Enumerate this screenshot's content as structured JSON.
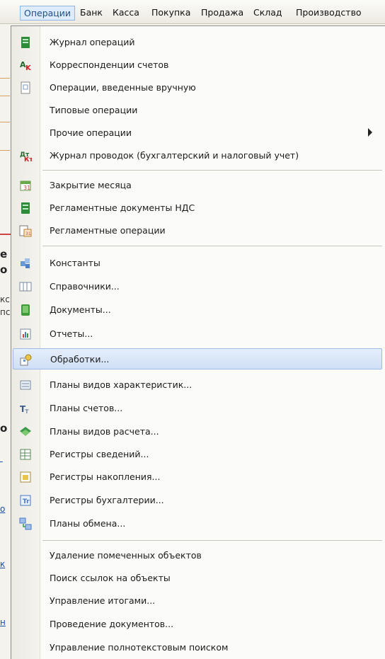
{
  "menubar": {
    "items": [
      "Операции",
      "Банк",
      "Касса",
      "Покупка",
      "Продажа",
      "Склад",
      "Производство"
    ]
  },
  "menu": {
    "items": [
      {
        "label": "Журнал операций",
        "icon": "journal-icon"
      },
      {
        "label": "Корреспонденции счетов",
        "icon": "account-correspondence-icon"
      },
      {
        "label": "Операции, введенные вручную",
        "icon": "manual-operations-icon"
      },
      {
        "label": "Типовые операции",
        "icon": ""
      },
      {
        "label": "Прочие операции",
        "icon": "",
        "submenu": true
      },
      {
        "label": "Журнал проводок (бухгалтерский и налоговый учет)",
        "icon": "postings-journal-icon"
      },
      {
        "label": "Закрытие месяца",
        "icon": "month-close-icon"
      },
      {
        "label": "Регламентные документы НДС",
        "icon": "vat-documents-icon"
      },
      {
        "label": "Регламентные операции",
        "icon": "scheduled-operations-icon"
      },
      {
        "label": "Константы",
        "icon": "constants-icon"
      },
      {
        "label": "Справочники...",
        "icon": "catalogs-icon"
      },
      {
        "label": "Документы...",
        "icon": "documents-icon"
      },
      {
        "label": "Отчеты...",
        "icon": "reports-icon"
      },
      {
        "label": "Обработки...",
        "icon": "data-processors-icon",
        "highlighted": true
      },
      {
        "label": "Планы видов характеристик...",
        "icon": "characteristic-types-icon"
      },
      {
        "label": "Планы счетов...",
        "icon": "chart-of-accounts-icon"
      },
      {
        "label": "Планы видов расчета...",
        "icon": "calculation-types-icon"
      },
      {
        "label": "Регистры сведений...",
        "icon": "info-registers-icon"
      },
      {
        "label": "Регистры накопления...",
        "icon": "accumulation-registers-icon"
      },
      {
        "label": "Регистры бухгалтерии...",
        "icon": "accounting-registers-icon"
      },
      {
        "label": "Планы обмена...",
        "icon": "exchange-plans-icon"
      },
      {
        "label": "Удаление помеченных объектов",
        "icon": ""
      },
      {
        "label": "Поиск ссылок на объекты",
        "icon": ""
      },
      {
        "label": "Управление итогами...",
        "icon": ""
      },
      {
        "label": "Проведение документов...",
        "icon": ""
      },
      {
        "label": "Управление полнотекстовым поиском",
        "icon": ""
      }
    ]
  },
  "background": {
    "fragments": [
      "е",
      "о",
      "кс",
      "пс",
      "о",
      "о",
      "к",
      "н"
    ]
  },
  "colors": {
    "highlight": "#cfdff5",
    "menubar_active": "#ddebfb"
  }
}
